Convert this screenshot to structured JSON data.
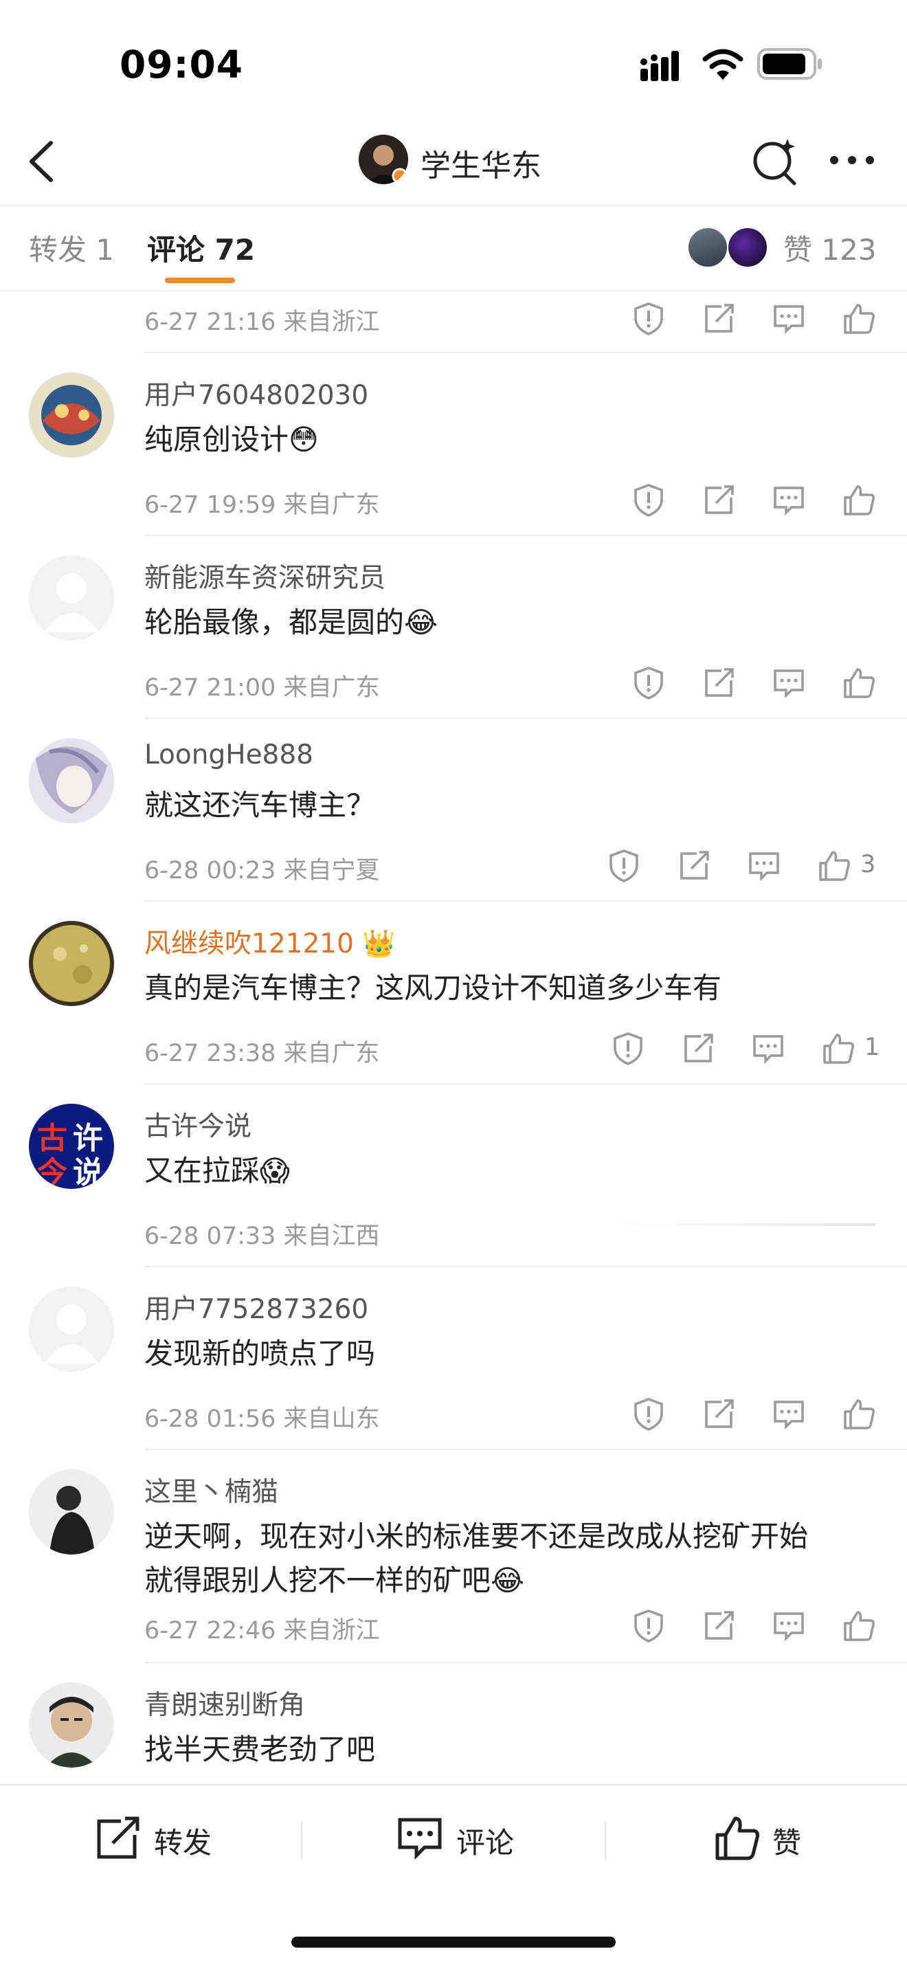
{
  "status_bar": {
    "time": "09:04"
  },
  "header": {
    "title": "学生华东"
  },
  "tabs": {
    "repost": "转发 1",
    "comment": "评论 72",
    "likes": "赞 123"
  },
  "top_partial": {
    "meta": "6-27 21:16  来自浙江"
  },
  "comments": [
    {
      "user": "用户7604802030",
      "text": "纯原创设计",
      "emoji": "😳",
      "meta": "6-27 19:59  来自广东",
      "likes": ""
    },
    {
      "user": "新能源车资深研究员",
      "text": "轮胎最像，都是圆的",
      "emoji": "😂",
      "meta": "6-27 21:00  来自广东",
      "likes": ""
    },
    {
      "user": "LoongHe888",
      "text": "就这还汽车博主？",
      "emoji": "",
      "meta": "6-28 00:23  来自宁夏",
      "likes": "3"
    },
    {
      "user": "风继续吹121210",
      "text": "真的是汽车博主？这风刀设计不知道多少车有",
      "emoji": "",
      "meta": "6-27 23:38  来自广东",
      "likes": "1"
    },
    {
      "user": "古许今说",
      "text": "又在拉踩",
      "emoji": "😱",
      "meta": "6-28 07:33  来自江西",
      "likes": ""
    },
    {
      "user": "用户7752873260",
      "text": "发现新的喷点了吗",
      "emoji": "",
      "meta": "6-28 01:56  来自山东",
      "likes": ""
    },
    {
      "user": "这里丶楠猫",
      "text": "逆天啊，现在对小米的标准要不还是改成从挖矿开始",
      "text2": "就得跟别人挖不一样的矿吧",
      "emoji": "😂",
      "meta": "6-27 22:46  来自浙江",
      "likes": ""
    },
    {
      "user": "青朗速别断角",
      "text": "找半天费老劲了吧",
      "emoji": "",
      "meta": "",
      "likes": ""
    }
  ],
  "bottom_bar": {
    "repost": "转发",
    "comment": "评论",
    "like": "赞"
  },
  "avatar_text": {
    "gu_xu": [
      "古",
      "许",
      "今",
      "说"
    ]
  },
  "colors": {
    "accent": "#f08a2b",
    "vip_name": "#e2711d"
  },
  "icons": [
    "back-icon",
    "search-icon",
    "more-icon",
    "report-icon",
    "share-icon",
    "comment-icon",
    "like-icon"
  ]
}
